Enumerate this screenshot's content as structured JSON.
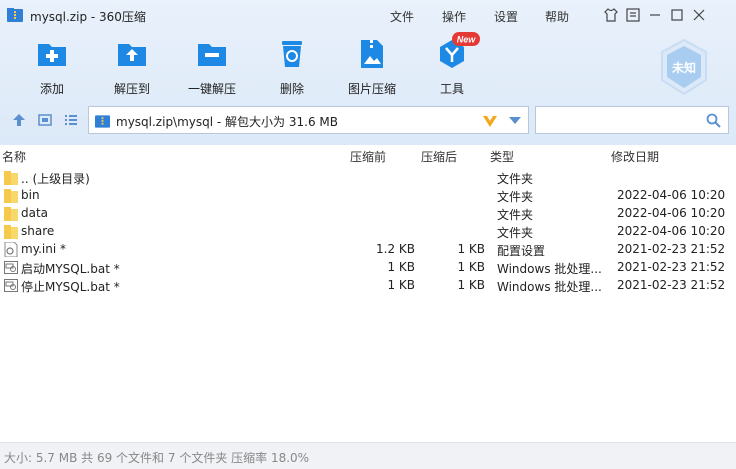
{
  "window": {
    "title": "mysql.zip - 360压缩"
  },
  "menu": [
    {
      "label": "文件"
    },
    {
      "label": "操作"
    },
    {
      "label": "设置"
    },
    {
      "label": "帮助"
    }
  ],
  "toolbar": [
    {
      "label": "添加",
      "icon": "add-icon"
    },
    {
      "label": "解压到",
      "icon": "extract-to-icon"
    },
    {
      "label": "一键解压",
      "icon": "one-click-extract-icon"
    },
    {
      "label": "删除",
      "icon": "delete-icon"
    },
    {
      "label": "图片压缩",
      "icon": "image-compress-icon"
    },
    {
      "label": "工具",
      "icon": "tools-icon",
      "badge": "New"
    }
  ],
  "security_badge": "未知",
  "address": {
    "path": "mysql.zip\\mysql - 解包大小为 31.6 MB"
  },
  "columns": {
    "name": "名称",
    "packed": "压缩前",
    "compressed": "压缩后",
    "type": "类型",
    "modified": "修改日期"
  },
  "files": [
    {
      "name": ".. (上级目录)",
      "before": "",
      "after": "",
      "type": "文件夹",
      "date": "",
      "kind": "folder"
    },
    {
      "name": "bin",
      "before": "",
      "after": "",
      "type": "文件夹",
      "date": "2022-04-06 10:20",
      "kind": "folder"
    },
    {
      "name": "data",
      "before": "",
      "after": "",
      "type": "文件夹",
      "date": "2022-04-06 10:20",
      "kind": "folder"
    },
    {
      "name": "share",
      "before": "",
      "after": "",
      "type": "文件夹",
      "date": "2022-04-06 10:20",
      "kind": "folder"
    },
    {
      "name": "my.ini *",
      "before": "1.2 KB",
      "after": "1 KB",
      "type": "配置设置",
      "date": "2021-02-23 21:52",
      "kind": "ini"
    },
    {
      "name": "启动MYSQL.bat *",
      "before": "1 KB",
      "after": "1 KB",
      "type": "Windows 批处理...",
      "date": "2021-02-23 21:52",
      "kind": "bat"
    },
    {
      "name": "停止MYSQL.bat *",
      "before": "1 KB",
      "after": "1 KB",
      "type": "Windows 批处理...",
      "date": "2021-02-23 21:52",
      "kind": "bat"
    }
  ],
  "status": "大小: 5.7 MB 共 69 个文件和 7 个文件夹 压缩率 18.0%",
  "colors": {
    "accent": "#1e88e5",
    "folder": "#f6c94c",
    "badge": "#e53935"
  }
}
